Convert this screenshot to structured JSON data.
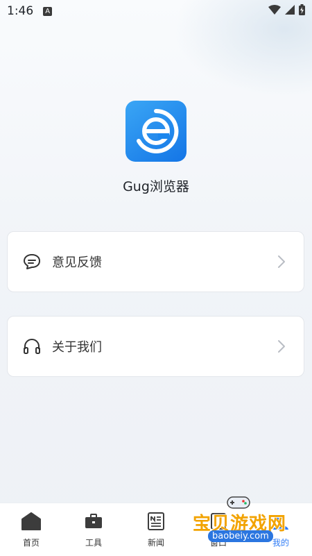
{
  "status_bar": {
    "time": "1:46",
    "notif_letter": "A"
  },
  "app": {
    "name": "Gug浏览器"
  },
  "menu": [
    {
      "label": "意见反馈",
      "icon": "chat-bubble-icon"
    },
    {
      "label": "关于我们",
      "icon": "headphones-icon"
    }
  ],
  "tabs": [
    {
      "label": "首页",
      "icon": "home-icon"
    },
    {
      "label": "工具",
      "icon": "toolbox-icon"
    },
    {
      "label": "新闻",
      "icon": "news-icon"
    },
    {
      "label": "窗口",
      "icon": "window-icon"
    },
    {
      "label": "我的",
      "icon": "profile-icon",
      "active": true
    }
  ],
  "watermark": {
    "text": "宝贝游戏网",
    "url": "baobeiy.com"
  },
  "colors": {
    "accent": "#2f7cf6",
    "logo_blue": "#1475e6",
    "watermark_orange": "#f2a300"
  }
}
